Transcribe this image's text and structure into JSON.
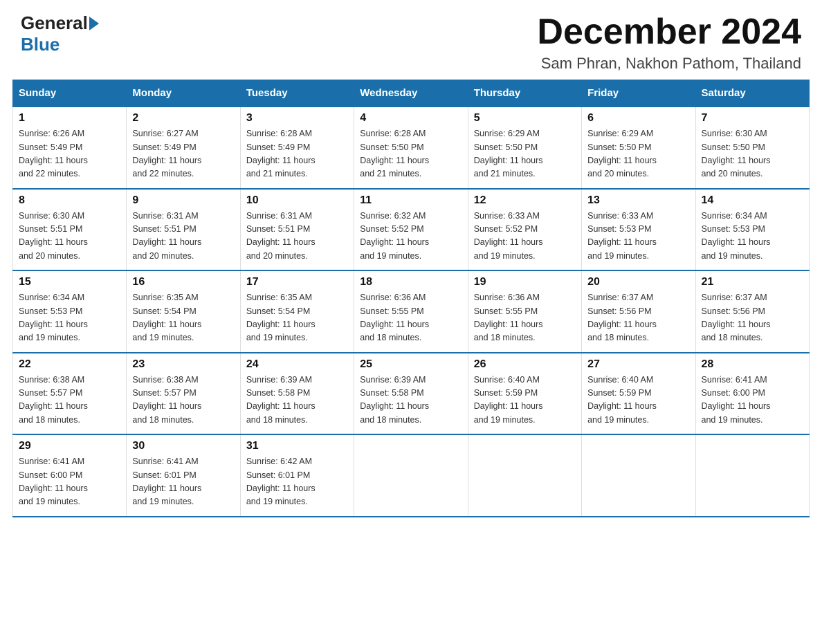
{
  "header": {
    "logo_general": "General",
    "logo_blue": "Blue",
    "month_title": "December 2024",
    "subtitle": "Sam Phran, Nakhon Pathom, Thailand"
  },
  "days_of_week": [
    "Sunday",
    "Monday",
    "Tuesday",
    "Wednesday",
    "Thursday",
    "Friday",
    "Saturday"
  ],
  "weeks": [
    [
      {
        "day": "1",
        "sunrise": "6:26 AM",
        "sunset": "5:49 PM",
        "daylight": "11 hours and 22 minutes."
      },
      {
        "day": "2",
        "sunrise": "6:27 AM",
        "sunset": "5:49 PM",
        "daylight": "11 hours and 22 minutes."
      },
      {
        "day": "3",
        "sunrise": "6:28 AM",
        "sunset": "5:49 PM",
        "daylight": "11 hours and 21 minutes."
      },
      {
        "day": "4",
        "sunrise": "6:28 AM",
        "sunset": "5:50 PM",
        "daylight": "11 hours and 21 minutes."
      },
      {
        "day": "5",
        "sunrise": "6:29 AM",
        "sunset": "5:50 PM",
        "daylight": "11 hours and 21 minutes."
      },
      {
        "day": "6",
        "sunrise": "6:29 AM",
        "sunset": "5:50 PM",
        "daylight": "11 hours and 20 minutes."
      },
      {
        "day": "7",
        "sunrise": "6:30 AM",
        "sunset": "5:50 PM",
        "daylight": "11 hours and 20 minutes."
      }
    ],
    [
      {
        "day": "8",
        "sunrise": "6:30 AM",
        "sunset": "5:51 PM",
        "daylight": "11 hours and 20 minutes."
      },
      {
        "day": "9",
        "sunrise": "6:31 AM",
        "sunset": "5:51 PM",
        "daylight": "11 hours and 20 minutes."
      },
      {
        "day": "10",
        "sunrise": "6:31 AM",
        "sunset": "5:51 PM",
        "daylight": "11 hours and 20 minutes."
      },
      {
        "day": "11",
        "sunrise": "6:32 AM",
        "sunset": "5:52 PM",
        "daylight": "11 hours and 19 minutes."
      },
      {
        "day": "12",
        "sunrise": "6:33 AM",
        "sunset": "5:52 PM",
        "daylight": "11 hours and 19 minutes."
      },
      {
        "day": "13",
        "sunrise": "6:33 AM",
        "sunset": "5:53 PM",
        "daylight": "11 hours and 19 minutes."
      },
      {
        "day": "14",
        "sunrise": "6:34 AM",
        "sunset": "5:53 PM",
        "daylight": "11 hours and 19 minutes."
      }
    ],
    [
      {
        "day": "15",
        "sunrise": "6:34 AM",
        "sunset": "5:53 PM",
        "daylight": "11 hours and 19 minutes."
      },
      {
        "day": "16",
        "sunrise": "6:35 AM",
        "sunset": "5:54 PM",
        "daylight": "11 hours and 19 minutes."
      },
      {
        "day": "17",
        "sunrise": "6:35 AM",
        "sunset": "5:54 PM",
        "daylight": "11 hours and 19 minutes."
      },
      {
        "day": "18",
        "sunrise": "6:36 AM",
        "sunset": "5:55 PM",
        "daylight": "11 hours and 18 minutes."
      },
      {
        "day": "19",
        "sunrise": "6:36 AM",
        "sunset": "5:55 PM",
        "daylight": "11 hours and 18 minutes."
      },
      {
        "day": "20",
        "sunrise": "6:37 AM",
        "sunset": "5:56 PM",
        "daylight": "11 hours and 18 minutes."
      },
      {
        "day": "21",
        "sunrise": "6:37 AM",
        "sunset": "5:56 PM",
        "daylight": "11 hours and 18 minutes."
      }
    ],
    [
      {
        "day": "22",
        "sunrise": "6:38 AM",
        "sunset": "5:57 PM",
        "daylight": "11 hours and 18 minutes."
      },
      {
        "day": "23",
        "sunrise": "6:38 AM",
        "sunset": "5:57 PM",
        "daylight": "11 hours and 18 minutes."
      },
      {
        "day": "24",
        "sunrise": "6:39 AM",
        "sunset": "5:58 PM",
        "daylight": "11 hours and 18 minutes."
      },
      {
        "day": "25",
        "sunrise": "6:39 AM",
        "sunset": "5:58 PM",
        "daylight": "11 hours and 18 minutes."
      },
      {
        "day": "26",
        "sunrise": "6:40 AM",
        "sunset": "5:59 PM",
        "daylight": "11 hours and 19 minutes."
      },
      {
        "day": "27",
        "sunrise": "6:40 AM",
        "sunset": "5:59 PM",
        "daylight": "11 hours and 19 minutes."
      },
      {
        "day": "28",
        "sunrise": "6:41 AM",
        "sunset": "6:00 PM",
        "daylight": "11 hours and 19 minutes."
      }
    ],
    [
      {
        "day": "29",
        "sunrise": "6:41 AM",
        "sunset": "6:00 PM",
        "daylight": "11 hours and 19 minutes."
      },
      {
        "day": "30",
        "sunrise": "6:41 AM",
        "sunset": "6:01 PM",
        "daylight": "11 hours and 19 minutes."
      },
      {
        "day": "31",
        "sunrise": "6:42 AM",
        "sunset": "6:01 PM",
        "daylight": "11 hours and 19 minutes."
      },
      null,
      null,
      null,
      null
    ]
  ],
  "labels": {
    "sunrise": "Sunrise:",
    "sunset": "Sunset:",
    "daylight": "Daylight:"
  }
}
